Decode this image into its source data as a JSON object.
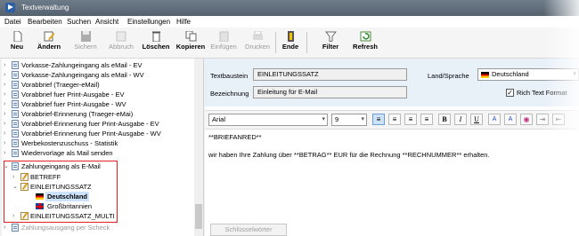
{
  "window": {
    "title": "Textverwaltung"
  },
  "menu": [
    "Datei",
    "Bearbeiten",
    "Suchen",
    "Ansicht",
    "Einstellungen",
    "Hilfe"
  ],
  "toolbar": {
    "neu": "Neu",
    "aendern": "Ändern",
    "sichern": "Sichern",
    "abbruch": "Abbruch",
    "loeschen": "Löschen",
    "kopieren": "Kopieren",
    "einfuegen": "Einfügen",
    "drucken": "Drucken",
    "ende": "Ende",
    "filter": "Filter",
    "refresh": "Refresh"
  },
  "tree": {
    "items": [
      "Vorkasse-Zahlungeingang als eMail - EV",
      "Vorkasse-Zahlungeingang als eMail - WV",
      "Vorabbrief (Traeger-eMail)",
      "Vorabbrief fuer Print-Ausgabe - EV",
      "Vorabbrief fuer Print-Ausgabe - WV",
      "Vorabbrief-Erinnerung (Traeger-eMai)",
      "Vorabbrief-Erinnerung fuer Print-Ausgabe - EV",
      "Vorabbrief-Erinnerung fuer Print-Ausgabe - WV",
      "Werbekostenzuschuss - Statistik",
      "Wiedervorlage als Mail senden"
    ],
    "group": "Zahlungeingang als E-Mail",
    "child1": "BETREFF",
    "child2": "EINLEITUNGSSATZ",
    "lang1": "Deutschland",
    "lang2": "Großbritannien",
    "child3": "EINLEITUNGSSATZ_MULTI",
    "cut": "Zahlungsausgang per Scheck"
  },
  "form": {
    "textbaustein_label": "Textbaustein",
    "textbaustein_value": "EINLEITUNGSSATZ",
    "bezeichnung_label": "Bezeichnung",
    "bezeichnung_value": "Einleitung für E-Mail",
    "land_label": "Land/Sprache",
    "land_value": "Deutschland",
    "richtext_label": "Rich Text Format",
    "richtext_checked": true
  },
  "format": {
    "font": "Arial",
    "size": "9"
  },
  "editor": {
    "line1": "**BRIEFANRED**",
    "line2": "wir haben Ihre Zahlung über **BETRAG** EUR für die Rechnung **RECHNUMMER** erhalten."
  },
  "footer": {
    "button": "Schlüsselwörter"
  }
}
